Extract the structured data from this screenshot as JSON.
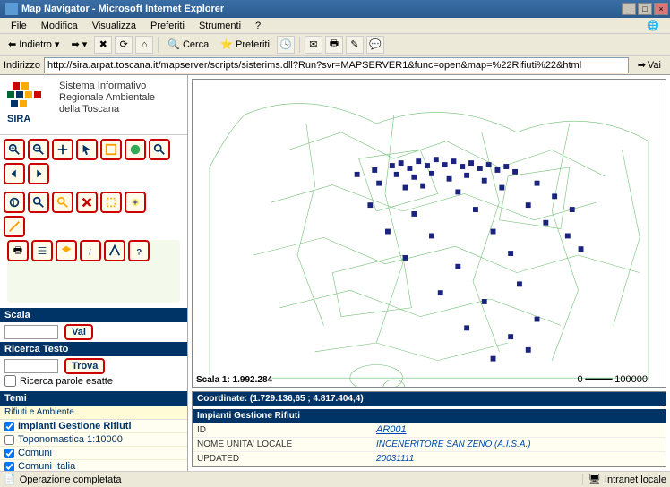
{
  "window": {
    "title": "Map Navigator - Microsoft Internet Explorer"
  },
  "menu": {
    "file": "File",
    "edit": "Modifica",
    "view": "Visualizza",
    "fav": "Preferiti",
    "tools": "Strumenti",
    "help": "?"
  },
  "toolbar": {
    "back": "Indietro",
    "search": "Cerca",
    "favorites": "Preferiti"
  },
  "address": {
    "label": "Indirizzo",
    "value": "http://sira.arpat.toscana.it/mapserver/scripts/sisterims.dll?Run?svr=MAPSERVER1&func=open&map=%22Rifiuti%22&html",
    "go": "Vai"
  },
  "logo": {
    "line1": "Sistema Informativo",
    "line2": "Regionale Ambientale",
    "line3": "della Toscana",
    "sira": "SIRA"
  },
  "scala": {
    "header": "Scala",
    "btn": "Vai"
  },
  "ricerca": {
    "header": "Ricerca Testo",
    "btn": "Trova",
    "exact_label": "Ricerca parole esatte"
  },
  "temi": {
    "header": "Temi",
    "subheader": "Rifiuti e Ambiente",
    "items": [
      {
        "label": "Impianti Gestione Rifiuti",
        "checked": true,
        "active": true
      },
      {
        "label": "Toponomastica 1:10000",
        "checked": false,
        "active": false
      },
      {
        "label": "Comuni",
        "checked": true,
        "active": false
      },
      {
        "label": "Comuni Italia",
        "checked": true,
        "active": false
      }
    ]
  },
  "map": {
    "scale_label": "Scala 1: 1.992.284",
    "bar_left": "0",
    "bar_right": "100000"
  },
  "coords": {
    "text": "Coordinate: (1.729.136,65 ; 4.817.404,4)"
  },
  "results": {
    "header": "Impianti Gestione Rifiuti",
    "rows": [
      {
        "k": "ID",
        "v": "AR001",
        "link": true
      },
      {
        "k": "NOME UNITA' LOCALE",
        "v": "INCENERITORE SAN ZENO (A.I.S.A.)",
        "link": false
      },
      {
        "k": "UPDATED",
        "v": "20031111",
        "link": false
      }
    ]
  },
  "status": {
    "left": "Operazione completata",
    "right": "Intranet locale"
  }
}
